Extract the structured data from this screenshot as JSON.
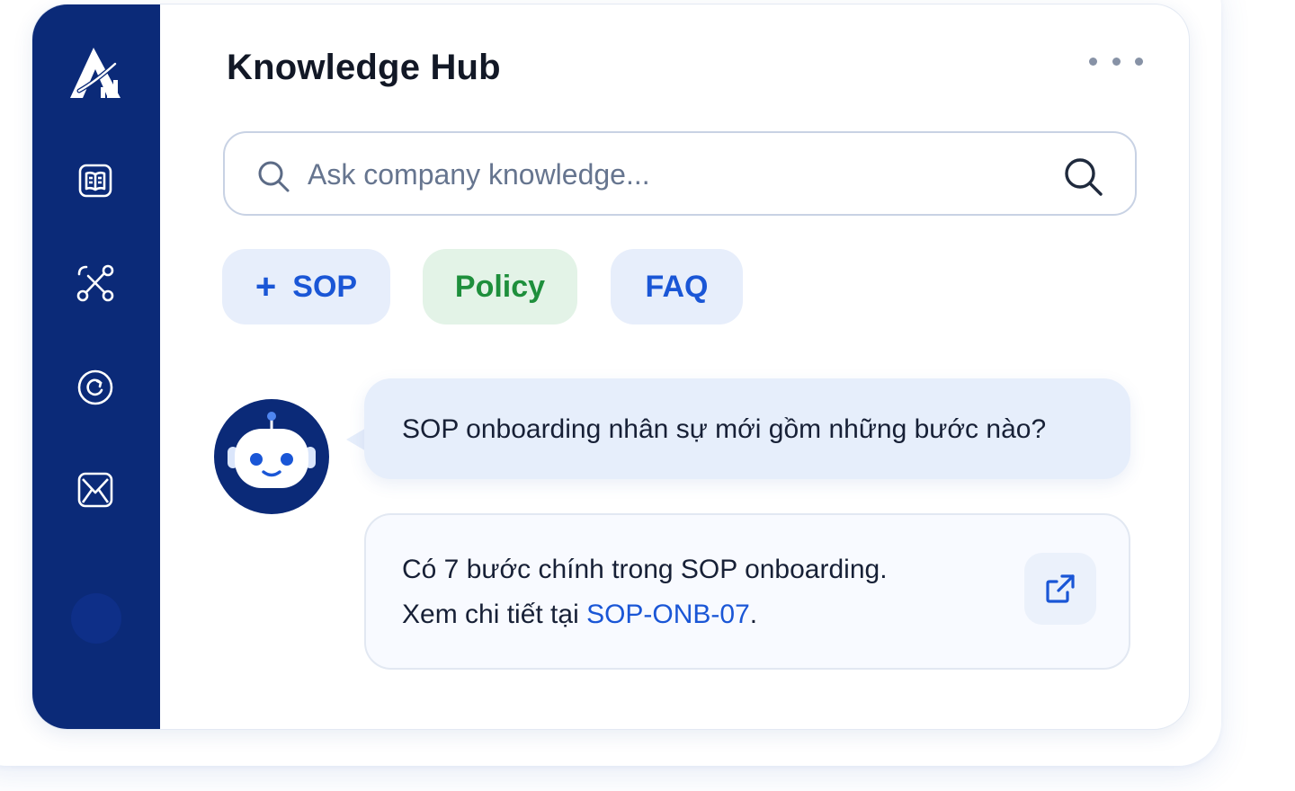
{
  "app": {
    "title": "Knowledge Hub"
  },
  "sidebar": {
    "logo": "logo-icon",
    "items": [
      {
        "icon": "knowledge-book-icon"
      },
      {
        "icon": "workflow-nodes-icon"
      },
      {
        "icon": "history-refresh-icon"
      },
      {
        "icon": "mail-icon"
      }
    ]
  },
  "header": {
    "more_icon": "more-dots-icon"
  },
  "search": {
    "placeholder": "Ask company knowledge..."
  },
  "chips": [
    {
      "label": "SOP",
      "prefix": "+"
    },
    {
      "label": "Policy"
    },
    {
      "label": "FAQ"
    }
  ],
  "chat": {
    "question": "SOP onboarding nhân sự mới gồm những bước nào?",
    "answer_line1": "Có 7 bước chính trong SOP onboarding.",
    "answer_line2_prefix": "Xem chi tiết tại ",
    "answer_link": "SOP-ONB-07",
    "answer_line2_suffix": "."
  },
  "colors": {
    "sidebar": "#0b2a78",
    "accent": "#1a56d6",
    "policy_green": "#1e8f3c",
    "bubble": "#e6eefb"
  }
}
